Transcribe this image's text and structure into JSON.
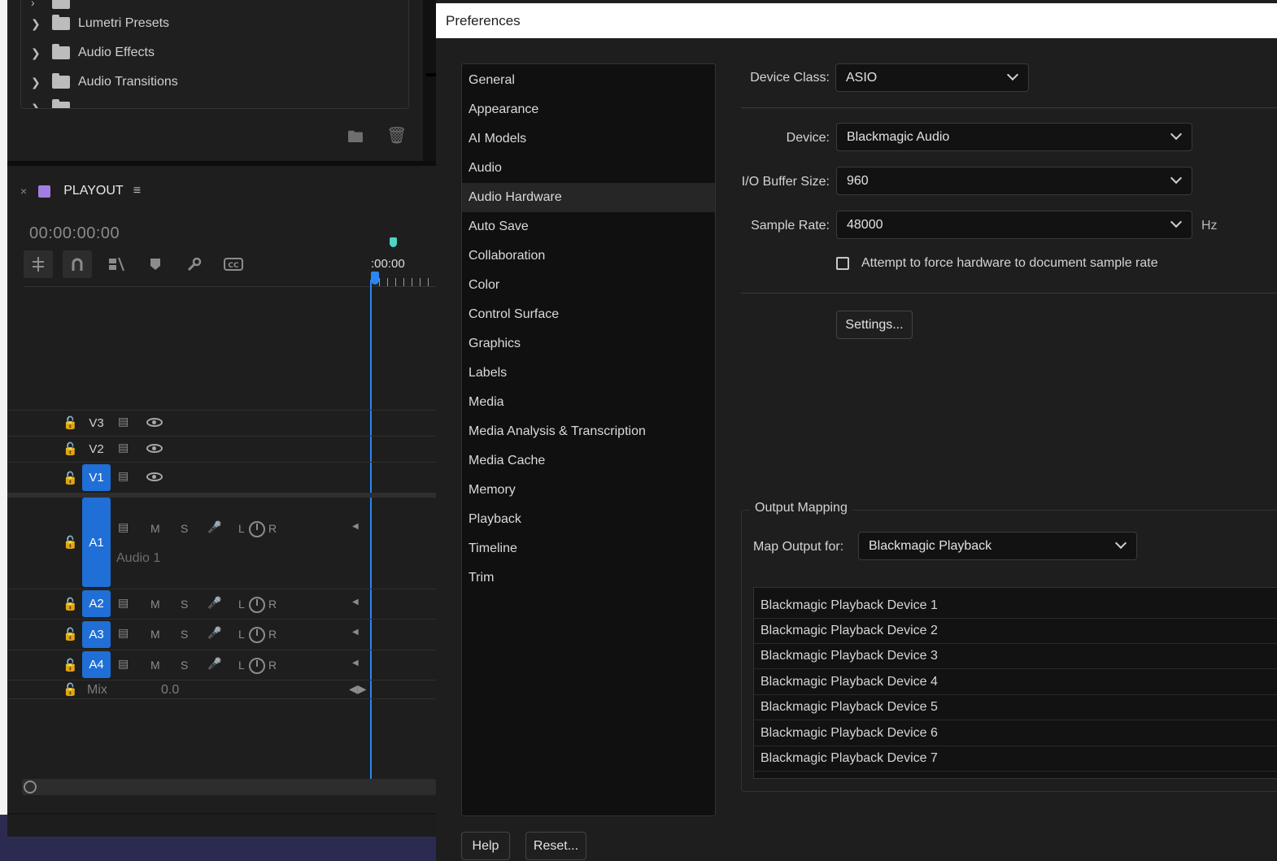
{
  "effects_panel": {
    "items": [
      {
        "label": "Lumetri Presets"
      },
      {
        "label": "Audio Effects"
      },
      {
        "label": "Audio Transitions"
      }
    ]
  },
  "timeline": {
    "close_glyph": "×",
    "sequence_name": "PLAYOUT",
    "sequence_color": "#a27ee0",
    "menu_glyph": "≡",
    "timecode": "00:00:00:00",
    "ruler_label": ":00:00",
    "tracks": {
      "v3": "V3",
      "v2": "V2",
      "v1": "V1",
      "a1": "A1",
      "a1_name": "Audio 1",
      "a2": "A2",
      "a3": "A3",
      "a4": "A4",
      "mix": "Mix",
      "mix_value": "0.0"
    },
    "audio_controls": {
      "mute": "M",
      "solo": "S",
      "left": "L",
      "right": "R"
    },
    "accent_color": "#1f6fd6",
    "playhead_color": "#2b86f0"
  },
  "preferences": {
    "title": "Preferences",
    "nav": [
      "General",
      "Appearance",
      "AI Models",
      "Audio",
      "Audio Hardware",
      "Auto Save",
      "Collaboration",
      "Color",
      "Control Surface",
      "Graphics",
      "Labels",
      "Media",
      "Media Analysis & Transcription",
      "Media Cache",
      "Memory",
      "Playback",
      "Timeline",
      "Trim"
    ],
    "selected_nav": "Audio Hardware",
    "device_class_label": "Device Class:",
    "device_class_value": "ASIO",
    "device_label": "Device:",
    "device_value": "Blackmagic Audio",
    "buffer_label": "I/O Buffer Size:",
    "buffer_value": "960",
    "sample_rate_label": "Sample Rate:",
    "sample_rate_value": "48000",
    "sample_rate_unit": "Hz",
    "force_label": "Attempt to force hardware to document sample rate",
    "force_checked": false,
    "settings_button": "Settings...",
    "output_mapping_legend": "Output Mapping",
    "map_output_label": "Map Output for:",
    "map_output_value": "Blackmagic Playback",
    "output_devices": [
      "Blackmagic Playback Device 1",
      "Blackmagic Playback Device 2",
      "Blackmagic Playback Device 3",
      "Blackmagic Playback Device 4",
      "Blackmagic Playback Device 5",
      "Blackmagic Playback Device 6",
      "Blackmagic Playback Device 7"
    ],
    "help_button": "Help",
    "reset_button": "Reset..."
  }
}
